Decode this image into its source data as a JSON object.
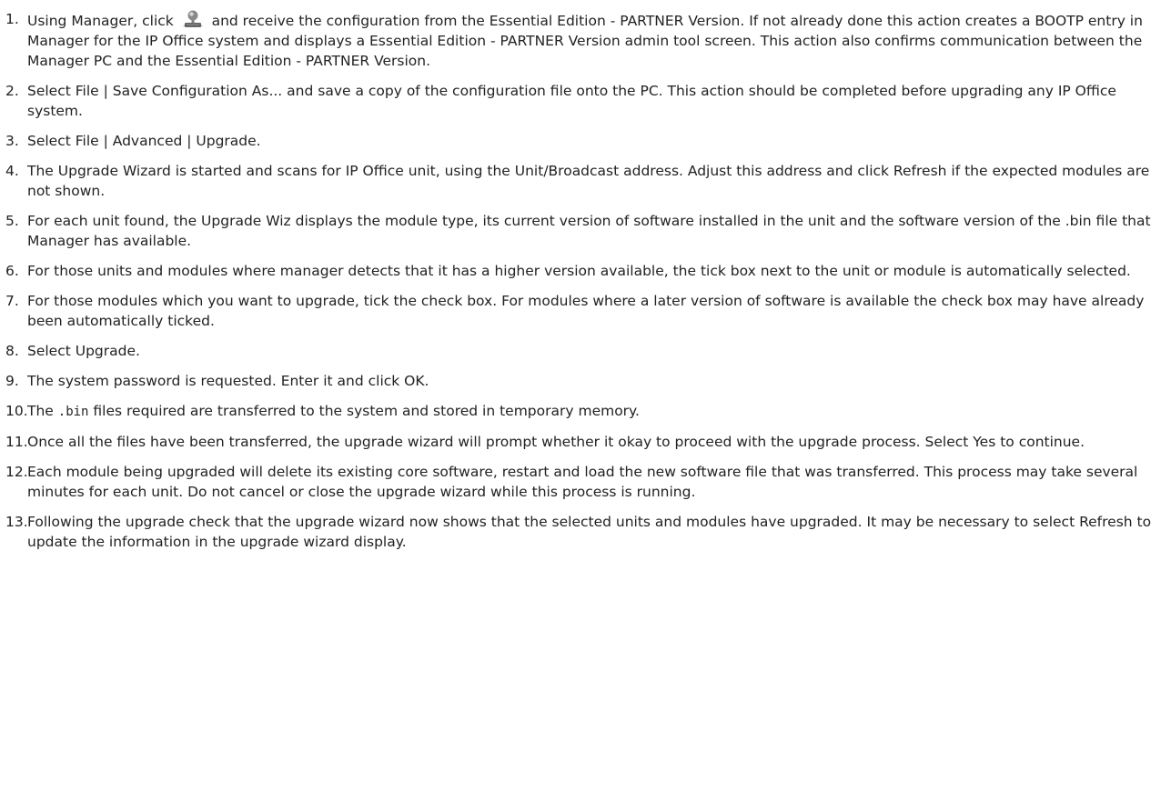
{
  "icons": {
    "receive_config": "receive-configuration-icon"
  },
  "steps": [
    {
      "number": "1.",
      "before_icon": "Using Manager, click ",
      "after_icon": " and receive the configuration from the Essential Edition - PARTNER Version. If not already done this action creates a BOOTP entry in Manager for the IP Office system and displays a Essential Edition - PARTNER Version admin tool screen. This action also confirms communication between the Manager PC and the Essential Edition - PARTNER Version."
    },
    {
      "number": "2.",
      "text": "Select File | Save Configuration As... and save a copy of the configuration file onto the PC. This action should be completed before upgrading any IP Office system."
    },
    {
      "number": "3.",
      "text": "Select File | Advanced | Upgrade."
    },
    {
      "number": "4.",
      "text": "The Upgrade Wizard is started and scans for IP Office unit, using the Unit/Broadcast address. Adjust this address and click Refresh if the expected modules are not shown."
    },
    {
      "number": "5.",
      "text": "For each unit found, the Upgrade Wiz displays the module type, its current version of software installed in the unit and the software version of the .bin file that Manager has available."
    },
    {
      "number": "6.",
      "text": "For those units and modules where manager detects that it has a higher version available, the tick box next to the unit or module is automatically selected."
    },
    {
      "number": "7.",
      "text": "For those modules which you want to upgrade, tick the check box. For modules where a later version of software is available the check box may have already been automatically ticked."
    },
    {
      "number": "8.",
      "text": "Select Upgrade."
    },
    {
      "number": "9.",
      "text": "The system password is requested. Enter it and click OK."
    },
    {
      "number": "10.",
      "before_code": "The ",
      "code": ".bin",
      "after_code": " files required are transferred to the system and stored in temporary memory."
    },
    {
      "number": "11.",
      "text": "Once all the files have been transferred, the upgrade wizard will prompt whether it okay to proceed with the upgrade process. Select Yes to continue."
    },
    {
      "number": "12.",
      "text": "Each module being upgraded will delete its existing core software, restart and load the new software file that was transferred. This process may take several minutes for each unit. Do not cancel or close the upgrade wizard while this process is running."
    },
    {
      "number": "13.",
      "text": "Following the upgrade check that the upgrade wizard now shows that the selected units and modules have upgraded. It may be necessary to select Refresh to update the information in the upgrade wizard display."
    }
  ]
}
